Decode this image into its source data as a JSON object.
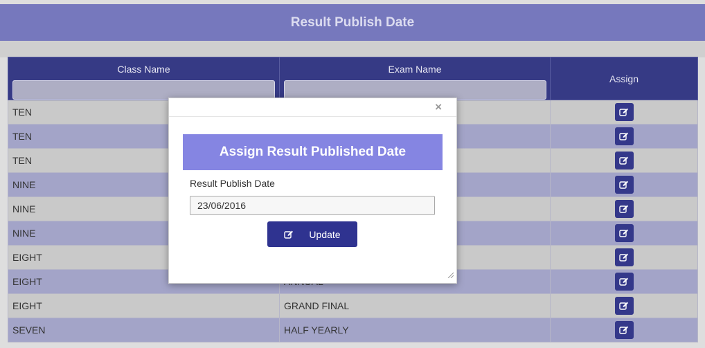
{
  "header": {
    "title": "Result Publish Date"
  },
  "table": {
    "columns": {
      "class_name": "Class Name",
      "exam_name": "Exam Name",
      "assign": "Assign"
    },
    "filters": {
      "class_name": "",
      "exam_name": ""
    },
    "rows": [
      {
        "class_name": "TEN",
        "exam_name": ""
      },
      {
        "class_name": "TEN",
        "exam_name": ""
      },
      {
        "class_name": "TEN",
        "exam_name": ""
      },
      {
        "class_name": "NINE",
        "exam_name": ""
      },
      {
        "class_name": "NINE",
        "exam_name": ""
      },
      {
        "class_name": "NINE",
        "exam_name": ""
      },
      {
        "class_name": "EIGHT",
        "exam_name": ""
      },
      {
        "class_name": "EIGHT",
        "exam_name": "ANNUAL"
      },
      {
        "class_name": "EIGHT",
        "exam_name": "GRAND FINAL"
      },
      {
        "class_name": "SEVEN",
        "exam_name": "HALF YEARLY"
      }
    ]
  },
  "modal": {
    "title": "Assign Result Published Date",
    "field_label": "Result Publish Date",
    "date_value": "23/06/2016",
    "update_label": "Update",
    "close_glyph": "×"
  },
  "icons": {
    "edit": "edit-icon",
    "close": "close-icon",
    "resize": "resize-grip-icon"
  },
  "colors": {
    "header_bg": "#7678bd",
    "table_header_bg": "#363a85",
    "row_odd": "#c9c9c9",
    "row_even": "#a3a4c8",
    "button_bg": "#2f3390",
    "modal_title_bg": "#8585e2"
  }
}
